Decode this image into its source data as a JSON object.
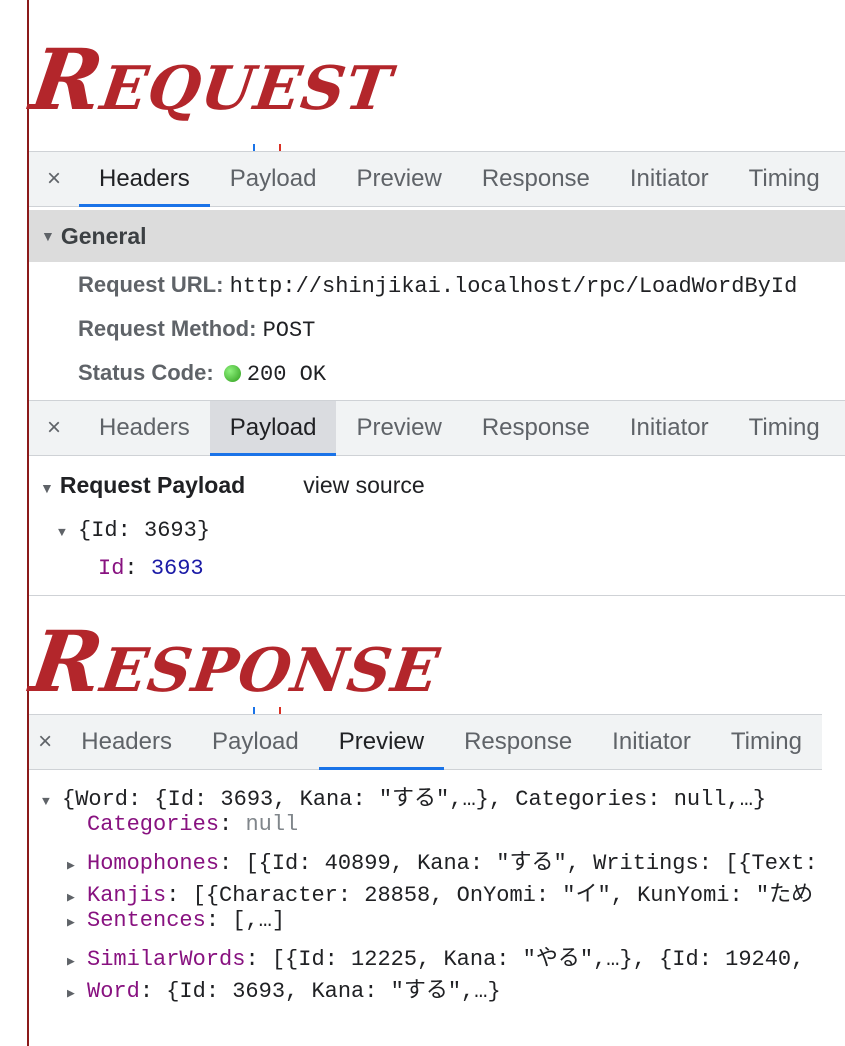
{
  "labels": {
    "request": "Request",
    "response": "Response"
  },
  "tabs": [
    "Headers",
    "Payload",
    "Preview",
    "Response",
    "Initiator",
    "Timing"
  ],
  "close_glyph": "×",
  "general": {
    "title": "General",
    "request_url_label": "Request URL:",
    "request_url": "http://shinjikai.localhost/rpc/LoadWordById",
    "method_label": "Request Method:",
    "method": "POST",
    "status_label": "Status Code:",
    "status": "200 OK"
  },
  "payload": {
    "title": "Request Payload",
    "view_source": "view source",
    "summary": "{Id: 3693}",
    "prop": "Id",
    "value": "3693"
  },
  "preview": {
    "summary": "{Word: {Id: 3693, Kana: \"する\",…}, Categories: null,…}",
    "categories_key": "Categories",
    "categories_value": "null",
    "homophones_key": "Homophones",
    "homophones_value": "[{Id: 40899, Kana: \"する\", Writings: [{Text:",
    "kanjis_key": "Kanjis",
    "kanjis_value": "[{Character: 28858, OnYomi: \"イ\", KunYomi: \"ため",
    "sentences_key": "Sentences",
    "sentences_value": "[,…]",
    "similar_key": "SimilarWords",
    "similar_value": "[{Id: 12225, Kana: \"やる\",…}, {Id: 19240, |",
    "word_key": "Word",
    "word_value": "{Id: 3693, Kana: \"する\",…}"
  },
  "colors": {
    "accent": "#1a73e8",
    "label_red": "#b3262b",
    "prop": "#881280",
    "number": "#1a1aa6"
  }
}
